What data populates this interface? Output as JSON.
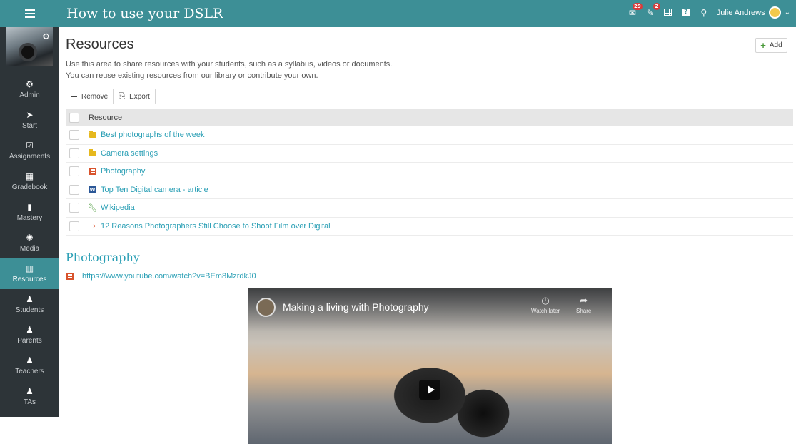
{
  "topbar": {
    "course_title": "How to use your DSLR",
    "notifications_badge": "29",
    "alerts_badge": "2",
    "help_label": "?",
    "user_name": "Julie Andrews"
  },
  "sidebar": {
    "items": [
      {
        "label": "Admin",
        "icon": "⚙"
      },
      {
        "label": "Start",
        "icon": "➤"
      },
      {
        "label": "Assignments",
        "icon": "☑"
      },
      {
        "label": "Gradebook",
        "icon": "▦"
      },
      {
        "label": "Mastery",
        "icon": "▮"
      },
      {
        "label": "Media",
        "icon": "✺"
      },
      {
        "label": "Resources",
        "icon": "▥"
      },
      {
        "label": "Students",
        "icon": "♟"
      },
      {
        "label": "Parents",
        "icon": "♟"
      },
      {
        "label": "Teachers",
        "icon": "♟"
      },
      {
        "label": "TAs",
        "icon": "♟"
      }
    ]
  },
  "main": {
    "title": "Resources",
    "add_label": "Add",
    "description_line1": "Use this area to share resources with your students, such as a syllabus, videos or documents.",
    "description_line2": "You can reuse existing resources from our library or contribute your own.",
    "remove_label": "Remove",
    "export_label": "Export",
    "column_header": "Resource",
    "resources": [
      {
        "name": "Best photographs of the week",
        "icon": "folder-icon"
      },
      {
        "name": "Camera settings",
        "icon": "folder-icon"
      },
      {
        "name": "Photography",
        "icon": "film-icon"
      },
      {
        "name": "Top Ten Digital camera - article",
        "icon": "word-document-icon"
      },
      {
        "name": "Wikipedia",
        "icon": "wrench-icon"
      },
      {
        "name": "12 Reasons Photographers Still Choose to Shoot Film over Digital",
        "icon": "arrow-right-icon"
      }
    ],
    "section_title": "Photography",
    "section_url": "https://www.youtube.com/watch?v=BEm8MzrdkJ0",
    "video": {
      "title": "Making a living with Photography",
      "watch_later": "Watch later",
      "share": "Share"
    }
  },
  "colors": {
    "accent": "#3d8f96",
    "sidebar": "#2d3438",
    "link": "#2a9fb5",
    "badge": "#d93a3a"
  }
}
